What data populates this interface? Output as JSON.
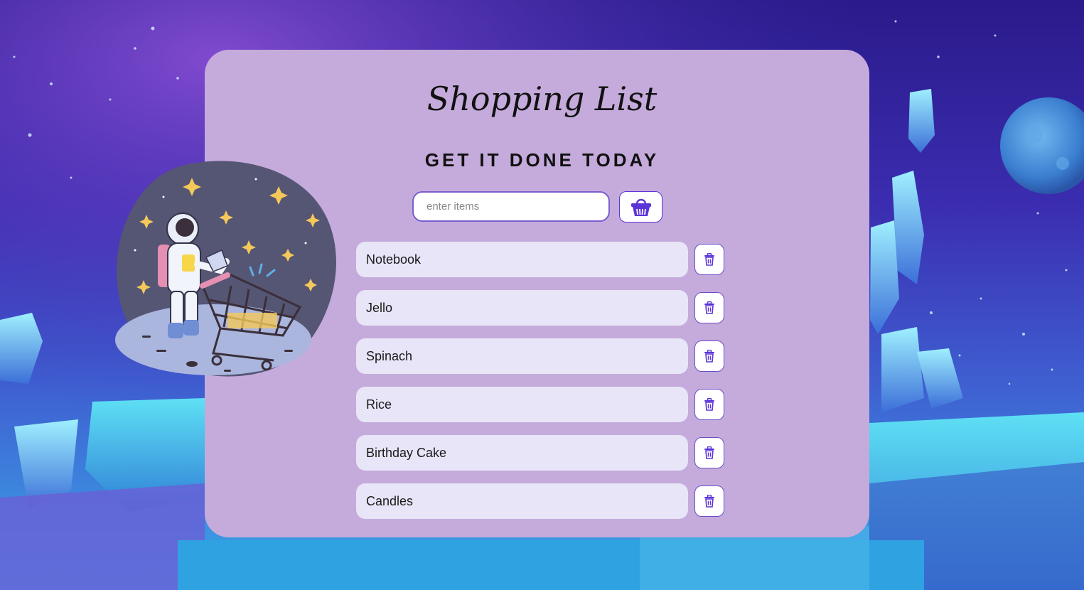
{
  "header": {
    "title": "Shopping List",
    "subtitle": "GET IT DONE TODAY"
  },
  "entry": {
    "placeholder": "enter items",
    "value": ""
  },
  "icons": {
    "add": "basket-icon",
    "delete": "trash-icon"
  },
  "colors": {
    "card": "#c5abdb",
    "item_pill": "#e7e5f7",
    "accent": "#5b35d8"
  },
  "items": [
    {
      "label": "Notebook"
    },
    {
      "label": "Jello"
    },
    {
      "label": "Spinach"
    },
    {
      "label": "Rice"
    },
    {
      "label": "Birthday Cake"
    },
    {
      "label": "Candles"
    }
  ]
}
